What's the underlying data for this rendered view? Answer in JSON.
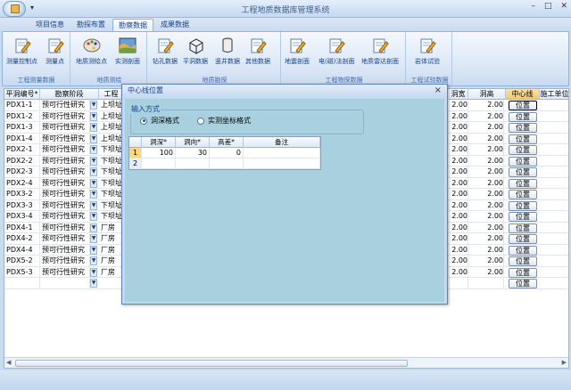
{
  "app": {
    "title": "工程地质数据库管理系统",
    "qat_symbol": "▾"
  },
  "window": {
    "minimize": "–",
    "maximize": "□",
    "close": "✕"
  },
  "tabs": [
    {
      "label": "项目信息"
    },
    {
      "label": "勘探布置"
    },
    {
      "label": "勘察数据",
      "active": true
    },
    {
      "label": "成果数据"
    }
  ],
  "ribbon": {
    "groups": [
      {
        "label": "工程测量数据",
        "buttons": [
          {
            "label": "测量控制点",
            "icon": "pencil-doc-icon"
          },
          {
            "label": "测量点",
            "icon": "pencil-doc-icon"
          }
        ]
      },
      {
        "label": "地质测绘",
        "buttons": [
          {
            "label": "地质测绘点",
            "icon": "palette-icon"
          },
          {
            "label": "实测剖面",
            "icon": "section-icon"
          }
        ]
      },
      {
        "label": "地质勘探",
        "buttons": [
          {
            "label": "钻孔数据",
            "icon": "pencil-doc-icon"
          },
          {
            "label": "平洞数据",
            "icon": "cube-icon"
          },
          {
            "label": "竖井数据",
            "icon": "cylinder-icon"
          },
          {
            "label": "其他数据",
            "icon": "pencil-doc-icon"
          }
        ]
      },
      {
        "label": "工程物探数据",
        "buttons": [
          {
            "label": "地震剖面",
            "icon": "pencil-doc-icon"
          },
          {
            "label": "电(磁)法剖面",
            "icon": "pencil-doc-icon"
          },
          {
            "label": "地质雷达剖面",
            "icon": "pencil-doc-icon"
          }
        ]
      },
      {
        "label": "工程试验数据",
        "buttons": [
          {
            "label": "岩体试验",
            "icon": "pencil-doc-icon"
          }
        ]
      }
    ]
  },
  "table": {
    "columns": [
      "平洞编号*",
      "勘察阶段",
      "工程",
      "洞宽",
      "洞高",
      "中心线",
      "施工单位"
    ],
    "rows": [
      {
        "id": "PDX1-1",
        "stage": "预可行性研究",
        "location": "上坝址",
        "width": "2.00",
        "height": "2.00",
        "btn": "位置"
      },
      {
        "id": "PDX1-2",
        "stage": "预可行性研究",
        "location": "上坝址",
        "width": "2.00",
        "height": "2.00",
        "btn": "位置"
      },
      {
        "id": "PDX1-3",
        "stage": "预可行性研究",
        "location": "上坝址",
        "width": "2.00",
        "height": "2.00",
        "btn": "位置"
      },
      {
        "id": "PDX1-4",
        "stage": "预可行性研究",
        "location": "上坝址",
        "width": "2.00",
        "height": "2.00",
        "btn": "位置"
      },
      {
        "id": "PDX2-1",
        "stage": "预可行性研究",
        "location": "下坝址",
        "width": "2.00",
        "height": "2.00",
        "btn": "位置"
      },
      {
        "id": "PDX2-2",
        "stage": "预可行性研究",
        "location": "下坝址",
        "width": "2.00",
        "height": "2.00",
        "btn": "位置"
      },
      {
        "id": "PDX2-3",
        "stage": "预可行性研究",
        "location": "下坝址",
        "width": "2.00",
        "height": "2.00",
        "btn": "位置"
      },
      {
        "id": "PDX2-4",
        "stage": "预可行性研究",
        "location": "下坝址",
        "width": "2.00",
        "height": "2.00",
        "btn": "位置"
      },
      {
        "id": "PDX3-2",
        "stage": "预可行性研究",
        "location": "下坝址",
        "width": "2.00",
        "height": "2.00",
        "btn": "位置"
      },
      {
        "id": "PDX3-3",
        "stage": "预可行性研究",
        "location": "下坝址",
        "width": "2.00",
        "height": "2.00",
        "btn": "位置"
      },
      {
        "id": "PDX3-4",
        "stage": "预可行性研究",
        "location": "下坝址",
        "width": "2.00",
        "height": "2.00",
        "btn": "位置"
      },
      {
        "id": "PDX4-1",
        "stage": "预可行性研究",
        "location": "厂房",
        "width": "2.00",
        "height": "2.00",
        "btn": "位置"
      },
      {
        "id": "PDX4-2",
        "stage": "预可行性研究",
        "location": "厂房",
        "width": "2.00",
        "height": "2.00",
        "btn": "位置"
      },
      {
        "id": "PDX4-4",
        "stage": "预可行性研究",
        "location": "厂房",
        "width": "2.00",
        "height": "2.00",
        "btn": "位置"
      },
      {
        "id": "PDX5-2",
        "stage": "预可行性研究",
        "location": "厂房",
        "width": "2.00",
        "height": "2.00",
        "btn": "位置"
      },
      {
        "id": "PDX5-3",
        "stage": "预可行性研究",
        "location": "厂房",
        "width": "2.00",
        "height": "2.00",
        "btn": "位置"
      },
      {
        "id": "",
        "stage": "",
        "location": "",
        "width": "",
        "height": "",
        "btn": "位置"
      }
    ]
  },
  "dialog": {
    "title": "中心线位置",
    "close": "×",
    "fieldset_legend": "输入方式",
    "radio_1": "洞深格式",
    "radio_2": "实测坐标格式",
    "grid_headers": [
      "",
      "洞深*",
      "洞向*",
      "高差*",
      "备注"
    ],
    "grid_rows": [
      {
        "num": "1",
        "depth": "100",
        "dir": "30",
        "diff": "0",
        "note": ""
      },
      {
        "num": "2",
        "depth": "",
        "dir": "",
        "diff": "",
        "note": ""
      }
    ]
  }
}
